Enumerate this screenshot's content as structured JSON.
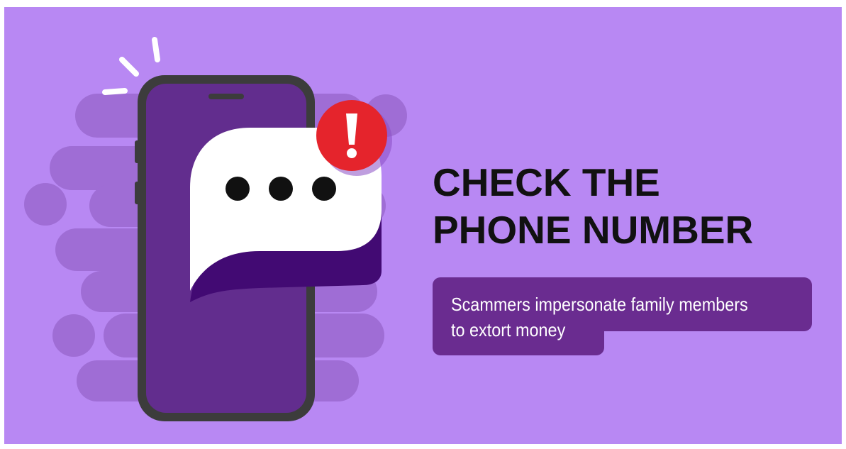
{
  "headline": {
    "line1": "CHECK THE",
    "line2": "PHONE NUMBER"
  },
  "caption": {
    "line1": "Scammers impersonate family members",
    "line2": "to extort money"
  },
  "colors": {
    "background": "#b888f3",
    "streak": "#9f6dd5",
    "phone_body": "#3c3c3c",
    "phone_screen": "#622d8e",
    "bubble": "#ffffff",
    "bubble_shadow": "#420a73",
    "alert": "#e5242c",
    "caption_box": "#6a2c90",
    "headline_text": "#111111",
    "caption_text": "#ffffff"
  },
  "icons": {
    "device": "smartphone-icon",
    "message": "typing-speech-bubble-icon",
    "alert": "exclamation-alert-icon"
  }
}
